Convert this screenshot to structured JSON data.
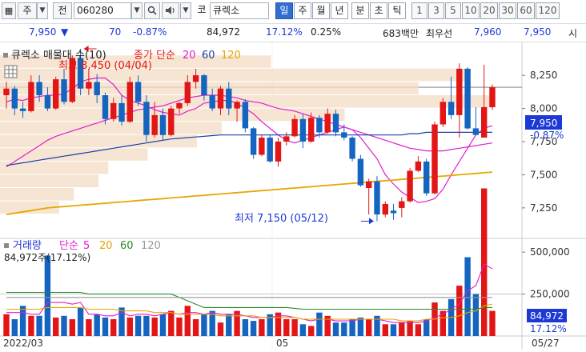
{
  "toolbar": {
    "market_label": "주",
    "prev_label": "전",
    "code": "060280",
    "exchange_label": "코",
    "stock_name": "큐렉소",
    "periods": [
      "일",
      "주",
      "월",
      "년",
      "분",
      "초",
      "틱"
    ],
    "selected_period": "일",
    "minutes": [
      "1",
      "3",
      "5",
      "10",
      "20",
      "30",
      "60",
      "120"
    ]
  },
  "info": {
    "price": "7,950",
    "change": "70",
    "change_pct": "-0.87%",
    "volume": "84,972",
    "volume_ratio": "17.12%",
    "turnover": "0.25%",
    "amount": "683백만",
    "best_label": "최우선",
    "ask": "7,960",
    "bid": "7,950",
    "tail": "시"
  },
  "price_panel": {
    "legend_name": "큐렉소 매물대 수(10)",
    "legend_ma_label": "종가 단순",
    "legend_ma_periods": [
      "20",
      "60",
      "120"
    ],
    "high_annotation": "최고 8,450 (04/04)",
    "low_annotation": "최저 7,150 (05/12)",
    "axis_labels": [
      "8,250",
      "8,000",
      "7,750",
      "7,500",
      "7,250"
    ],
    "current_price_tag": "7,950",
    "current_pct_tag": "-0.87%"
  },
  "volume_panel": {
    "legend_name": "거래량",
    "legend_ma_label": "단순",
    "legend_ma_periods": [
      "5",
      "20",
      "60",
      "120"
    ],
    "current_label": "84,972주(17.12%)",
    "axis_labels": [
      "500,000",
      "250,000"
    ],
    "current_tag": "84,972",
    "current_pct_tag": "17.12%"
  },
  "x_axis_labels": [
    "2022/03",
    "05",
    "05/27"
  ],
  "colors": {
    "up": "#e21616",
    "down": "#1565c0",
    "ma5": "#e01ecc",
    "ma20": "#e8a600",
    "ma60": "#2a8a2a",
    "ma120": "#999999",
    "volume_profile": "#f4dcc4"
  },
  "chart_data": {
    "type": "candlestick",
    "ohlc": [
      [
        8100,
        8200,
        8000,
        8150
      ],
      [
        8150,
        8170,
        7950,
        8000
      ],
      [
        8000,
        8050,
        7930,
        7980
      ],
      [
        7980,
        8250,
        7970,
        8200
      ],
      [
        8200,
        8250,
        8050,
        8100
      ],
      [
        8100,
        8160,
        7980,
        8000
      ],
      [
        8000,
        8240,
        7990,
        8220
      ],
      [
        8220,
        8300,
        8030,
        8050
      ],
      [
        8050,
        8400,
        8040,
        8380
      ],
      [
        8380,
        8450,
        8100,
        8150
      ],
      [
        8150,
        8300,
        8100,
        8200
      ],
      [
        8200,
        8260,
        8040,
        8100
      ],
      [
        8100,
        8120,
        7880,
        7920
      ],
      [
        7920,
        8080,
        7900,
        8040
      ],
      [
        8040,
        8100,
        7870,
        7900
      ],
      [
        7900,
        8240,
        7890,
        8200
      ],
      [
        8200,
        8250,
        8020,
        8050
      ],
      [
        8050,
        8100,
        7750,
        7800
      ],
      [
        7800,
        8050,
        7780,
        7950
      ],
      [
        7950,
        8000,
        7760,
        7800
      ],
      [
        7800,
        8020,
        7790,
        8000
      ],
      [
        8000,
        8050,
        7960,
        8040
      ],
      [
        8040,
        8250,
        8020,
        8200
      ],
      [
        8200,
        8300,
        8150,
        8250
      ],
      [
        8250,
        8260,
        8060,
        8100
      ],
      [
        8100,
        8150,
        7980,
        8000
      ],
      [
        8000,
        8170,
        7950,
        8150
      ],
      [
        8150,
        8200,
        7950,
        8000
      ],
      [
        8000,
        8060,
        7900,
        8050
      ],
      [
        8050,
        8070,
        7820,
        7850
      ],
      [
        7850,
        7860,
        7620,
        7650
      ],
      [
        7650,
        7800,
        7640,
        7780
      ],
      [
        7780,
        7800,
        7590,
        7600
      ],
      [
        7600,
        7780,
        7560,
        7750
      ],
      [
        7750,
        7820,
        7720,
        7790
      ],
      [
        7790,
        7950,
        7780,
        7920
      ],
      [
        7920,
        7960,
        7700,
        7750
      ],
      [
        7750,
        7970,
        7740,
        7930
      ],
      [
        7930,
        7950,
        7780,
        7820
      ],
      [
        7820,
        8000,
        7810,
        7960
      ],
      [
        7960,
        7990,
        7790,
        7820
      ],
      [
        7820,
        7880,
        7760,
        7780
      ],
      [
        7780,
        7790,
        7600,
        7620
      ],
      [
        7620,
        7650,
        7410,
        7420
      ],
      [
        7400,
        7470,
        7200,
        7450
      ],
      [
        7450,
        7490,
        7150,
        7200
      ],
      [
        7200,
        7300,
        7180,
        7280
      ],
      [
        7230,
        7280,
        7160,
        7210
      ],
      [
        7250,
        7330,
        7180,
        7300
      ],
      [
        7300,
        7550,
        7290,
        7530
      ],
      [
        7530,
        7640,
        7520,
        7600
      ],
      [
        7600,
        7620,
        7340,
        7360
      ],
      [
        7360,
        7900,
        7350,
        7880
      ],
      [
        7880,
        8080,
        7860,
        8050
      ],
      [
        8050,
        8240,
        7920,
        7950
      ],
      [
        7950,
        8340,
        7780,
        8300
      ],
      [
        8300,
        8310,
        7840,
        7850
      ],
      [
        7850,
        8010,
        7850,
        7800
      ],
      [
        7780,
        8330,
        7780,
        8010
      ],
      [
        8010,
        8180,
        7990,
        8160
      ]
    ],
    "volume": [
      130,
      100,
      180,
      120,
      120,
      480,
      110,
      120,
      100,
      170,
      100,
      130,
      110,
      100,
      170,
      110,
      120,
      120,
      110,
      130,
      150,
      110,
      180,
      100,
      130,
      150,
      80,
      130,
      150,
      100,
      90,
      100,
      130,
      140,
      100,
      100,
      70,
      60,
      140,
      120,
      80,
      80,
      100,
      110,
      100,
      120,
      70,
      70,
      80,
      90,
      70,
      100,
      200,
      150,
      220,
      300,
      470,
      250,
      880,
      150
    ],
    "volume_unit": "thousand shares",
    "ma": {
      "5": [
        8050,
        8070,
        8060,
        8080,
        8090,
        8100,
        8100,
        8110,
        8150,
        8200,
        8220,
        8230,
        8230,
        8180,
        8100,
        8060,
        8040,
        8020,
        7990,
        7970,
        7960,
        7950,
        7980,
        8000,
        8040,
        8050,
        8060,
        8060,
        8040,
        8000,
        7960,
        7900,
        7850,
        7800,
        7760,
        7740,
        7760,
        7780,
        7800,
        7820,
        7840,
        7860,
        7840,
        7780,
        7700,
        7620,
        7500,
        7430,
        7370,
        7330,
        7290,
        7300,
        7320,
        7390,
        7500,
        7600,
        7700,
        7800,
        7850,
        7870
      ],
      "20": [
        7560,
        7600,
        7640,
        7680,
        7720,
        7760,
        7790,
        7810,
        7830,
        7850,
        7870,
        7890,
        7910,
        7930,
        7950,
        7970,
        7990,
        8000,
        8010,
        8020,
        8040,
        8060,
        8080,
        8090,
        8100,
        8100,
        8100,
        8090,
        8080,
        8060,
        8050,
        8040,
        8020,
        8000,
        7990,
        7980,
        7960,
        7940,
        7920,
        7900,
        7880,
        7860,
        7840,
        7820,
        7800,
        7780,
        7760,
        7740,
        7720,
        7700,
        7690,
        7680,
        7680,
        7680,
        7690,
        7700,
        7710,
        7720,
        7730,
        7740
      ],
      "60": [
        7570,
        7580,
        7590,
        7600,
        7610,
        7620,
        7630,
        7640,
        7650,
        7660,
        7670,
        7680,
        7690,
        7700,
        7710,
        7720,
        7730,
        7740,
        7750,
        7760,
        7770,
        7775,
        7780,
        7785,
        7790,
        7795,
        7800,
        7800,
        7800,
        7800,
        7800,
        7800,
        7800,
        7800,
        7800,
        7800,
        7800,
        7800,
        7800,
        7800,
        7800,
        7800,
        7800,
        7800,
        7800,
        7800,
        7800,
        7800,
        7800,
        7810,
        7810,
        7820,
        7820,
        7820,
        7820,
        7820,
        7820,
        7820,
        7820,
        7820
      ],
      "120": [
        7200,
        7210,
        7220,
        7230,
        7240,
        7250,
        7255,
        7260,
        7265,
        7270,
        7275,
        7280,
        7285,
        7290,
        7295,
        7300,
        7305,
        7310,
        7315,
        7320,
        7325,
        7330,
        7335,
        7340,
        7345,
        7350,
        7355,
        7360,
        7365,
        7370,
        7375,
        7380,
        7385,
        7390,
        7395,
        7400,
        7405,
        7410,
        7415,
        7420,
        7425,
        7430,
        7435,
        7440,
        7445,
        7450,
        7455,
        7460,
        7465,
        7470,
        7475,
        7480,
        7485,
        7490,
        7495,
        7500,
        7505,
        7510,
        7515,
        7520
      ]
    },
    "volume_ma": {
      "5": [
        140,
        140,
        140,
        130,
        130,
        200,
        200,
        200,
        190,
        200,
        130,
        130,
        120,
        120,
        140,
        120,
        130,
        130,
        120,
        130,
        140,
        130,
        140,
        140,
        130,
        140,
        130,
        130,
        130,
        120,
        110,
        110,
        110,
        120,
        120,
        110,
        100,
        90,
        100,
        100,
        90,
        90,
        90,
        100,
        100,
        100,
        90,
        80,
        80,
        80,
        80,
        90,
        110,
        130,
        160,
        190,
        270,
        300,
        430,
        400
      ],
      "20": [
        160,
        160,
        160,
        160,
        160,
        170,
        170,
        170,
        170,
        170,
        160,
        160,
        160,
        160,
        150,
        150,
        150,
        150,
        140,
        140,
        140,
        130,
        130,
        130,
        130,
        130,
        120,
        120,
        120,
        120,
        120,
        110,
        110,
        110,
        110,
        110,
        100,
        100,
        100,
        100,
        100,
        100,
        100,
        100,
        100,
        100,
        100,
        100,
        90,
        90,
        90,
        100,
        100,
        110,
        110,
        120,
        140,
        150,
        180,
        190
      ],
      "60": [
        260,
        260,
        260,
        260,
        260,
        260,
        260,
        260,
        260,
        260,
        250,
        250,
        250,
        250,
        250,
        250,
        250,
        250,
        250,
        250,
        250,
        230,
        210,
        190,
        170,
        170,
        170,
        170,
        170,
        170,
        170,
        170,
        170,
        170,
        170,
        165,
        160,
        160,
        160,
        160,
        160,
        160,
        160,
        160,
        160,
        160,
        160,
        160,
        160,
        160,
        160,
        160,
        160,
        160,
        160,
        160,
        160,
        160,
        170,
        170
      ],
      "120": [
        230,
        230,
        230,
        230,
        230,
        230,
        230,
        230,
        230,
        230,
        230,
        230,
        230,
        230,
        230,
        230,
        230,
        230,
        230,
        230,
        230,
        230,
        230,
        230,
        230,
        230,
        230,
        230,
        230,
        230,
        230,
        230,
        230,
        230,
        230,
        230,
        230,
        230,
        230,
        230,
        230,
        230,
        230,
        230,
        230,
        230,
        230,
        230,
        230,
        230,
        230,
        230,
        230,
        230,
        230,
        230,
        230,
        230,
        230,
        230
      ]
    },
    "volume_profile": [
      {
        "price": 8350,
        "strength": 0.55
      },
      {
        "price": 8250,
        "strength": 0.95
      },
      {
        "price": 8150,
        "strength": 0.85
      },
      {
        "price": 8050,
        "strength": 1.0
      },
      {
        "price": 7950,
        "strength": 0.7
      },
      {
        "price": 7850,
        "strength": 0.45
      },
      {
        "price": 7750,
        "strength": 0.4
      },
      {
        "price": 7650,
        "strength": 0.3
      },
      {
        "price": 7550,
        "strength": 0.22
      },
      {
        "price": 7450,
        "strength": 0.2
      },
      {
        "price": 7350,
        "strength": 0.15
      },
      {
        "price": 7250,
        "strength": 0.12
      }
    ],
    "y_range": [
      7050,
      8450
    ],
    "volume_range_thousands": [
      0,
      520
    ]
  }
}
